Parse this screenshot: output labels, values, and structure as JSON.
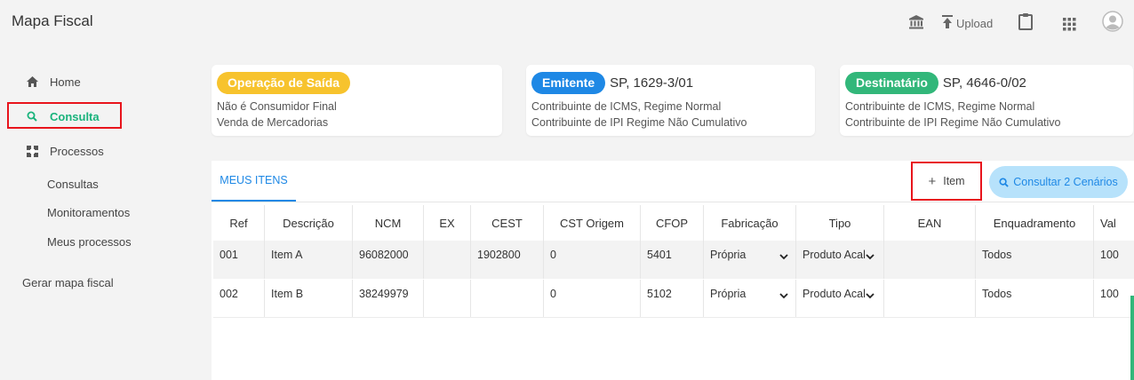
{
  "app": {
    "title": "Mapa Fiscal"
  },
  "top": {
    "upload_label": "Upload"
  },
  "icons": {
    "bank": "bank-icon",
    "upload": "upload-icon",
    "clipboard": "clipboard-icon",
    "apps": "apps-grid-icon",
    "user": "user-avatar-icon"
  },
  "sidebar": {
    "home": "Home",
    "consulta": "Consulta",
    "processos": "Processos",
    "sub": [
      "Consultas",
      "Monitoramentos",
      "Meus processos"
    ],
    "gerar": "Gerar mapa fiscal"
  },
  "cards": {
    "operacao": {
      "pill": "Operação de Saída",
      "line1": "Não é Consumidor Final",
      "line2": "Venda de Mercadorias"
    },
    "emitente": {
      "pill": "Emitente",
      "value": "SP, 1629-3/01",
      "line1": "Contribuinte de ICMS, Regime Normal",
      "line2": "Contribuinte de IPI Regime Não Cumulativo"
    },
    "destinatario": {
      "pill": "Destinatário",
      "value": "SP, 4646-0/02",
      "line1": "Contribuinte de ICMS, Regime Normal",
      "line2": "Contribuinte de IPI Regime Não Cumulativo"
    }
  },
  "panel": {
    "tab": "MEUS ITENS",
    "add_item": "Item",
    "consult": "Consultar 2 Cenários"
  },
  "table": {
    "headers": [
      "Ref",
      "Descrição",
      "NCM",
      "EX",
      "CEST",
      "CST Origem",
      "CFOP",
      "Fabricação",
      "Tipo",
      "EAN",
      "Enquadramento",
      "Val"
    ],
    "rows": [
      [
        "001",
        "Item A",
        "96082000",
        "",
        "1902800",
        "0",
        "5401",
        "Própria",
        "Produto Acal",
        "",
        "Todos",
        "100"
      ],
      [
        "002",
        "Item B",
        "38249979",
        "",
        "",
        "0",
        "5102",
        "Própria",
        "Produto Acal",
        "",
        "Todos",
        "100"
      ]
    ]
  },
  "colors": {
    "accent_green": "#32b77a",
    "accent_blue": "#1e88e5",
    "pill_yellow": "#f7c32d",
    "highlight_red": "#e8141c"
  }
}
